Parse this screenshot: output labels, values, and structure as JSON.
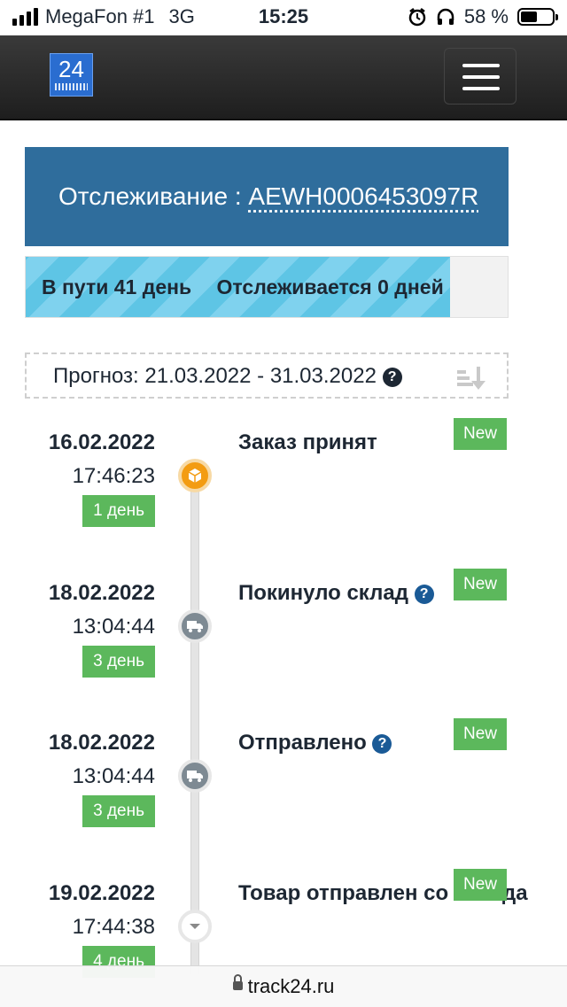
{
  "status_bar": {
    "carrier": "MegaFon #1",
    "network": "3G",
    "time": "15:25",
    "battery_text": "58 %",
    "battery_level": 0.58,
    "icons": [
      "signal-icon",
      "alarm-icon",
      "headphones-icon",
      "battery-icon"
    ]
  },
  "nav": {
    "logo_text": "24",
    "menu_icon": "hamburger-menu-icon"
  },
  "tracking": {
    "label": "Отслеживание :",
    "number": "AEWH0006453097R"
  },
  "progress": {
    "in_transit": "В пути 41 день",
    "tracked": "Отслеживается 0 дней",
    "fill_fraction": 0.88
  },
  "forecast": {
    "text": "Прогноз: 21.03.2022 - 31.03.2022",
    "help_icon": "question-icon",
    "sort_icon": "sort-icon"
  },
  "events": [
    {
      "date": "16.02.2022",
      "time": "17:46:23",
      "days": "1 день",
      "title": "Заказ принят",
      "badge": "New",
      "has_help": false,
      "icon": "package-icon"
    },
    {
      "date": "18.02.2022",
      "time": "13:04:44",
      "days": "3 день",
      "title": "Покинуло склад",
      "badge": "New",
      "has_help": true,
      "icon": "truck-icon"
    },
    {
      "date": "18.02.2022",
      "time": "13:04:44",
      "days": "3 день",
      "title": "Отправлено",
      "badge": "New",
      "has_help": true,
      "icon": "truck-icon"
    },
    {
      "date": "19.02.2022",
      "time": "17:44:38",
      "days": "4 день",
      "title": "Товар отправлен со склада",
      "badge": "New",
      "has_help": false,
      "icon": "chevron-down-icon"
    }
  ],
  "colors": {
    "header_blue": "#2f6d9c",
    "progress_fill": "#5ec5e5",
    "badge_green": "#5cb85c",
    "node_orange": "#f39c12",
    "node_gray": "#7e8a93"
  },
  "urlbar": {
    "url": "track24.ru"
  }
}
